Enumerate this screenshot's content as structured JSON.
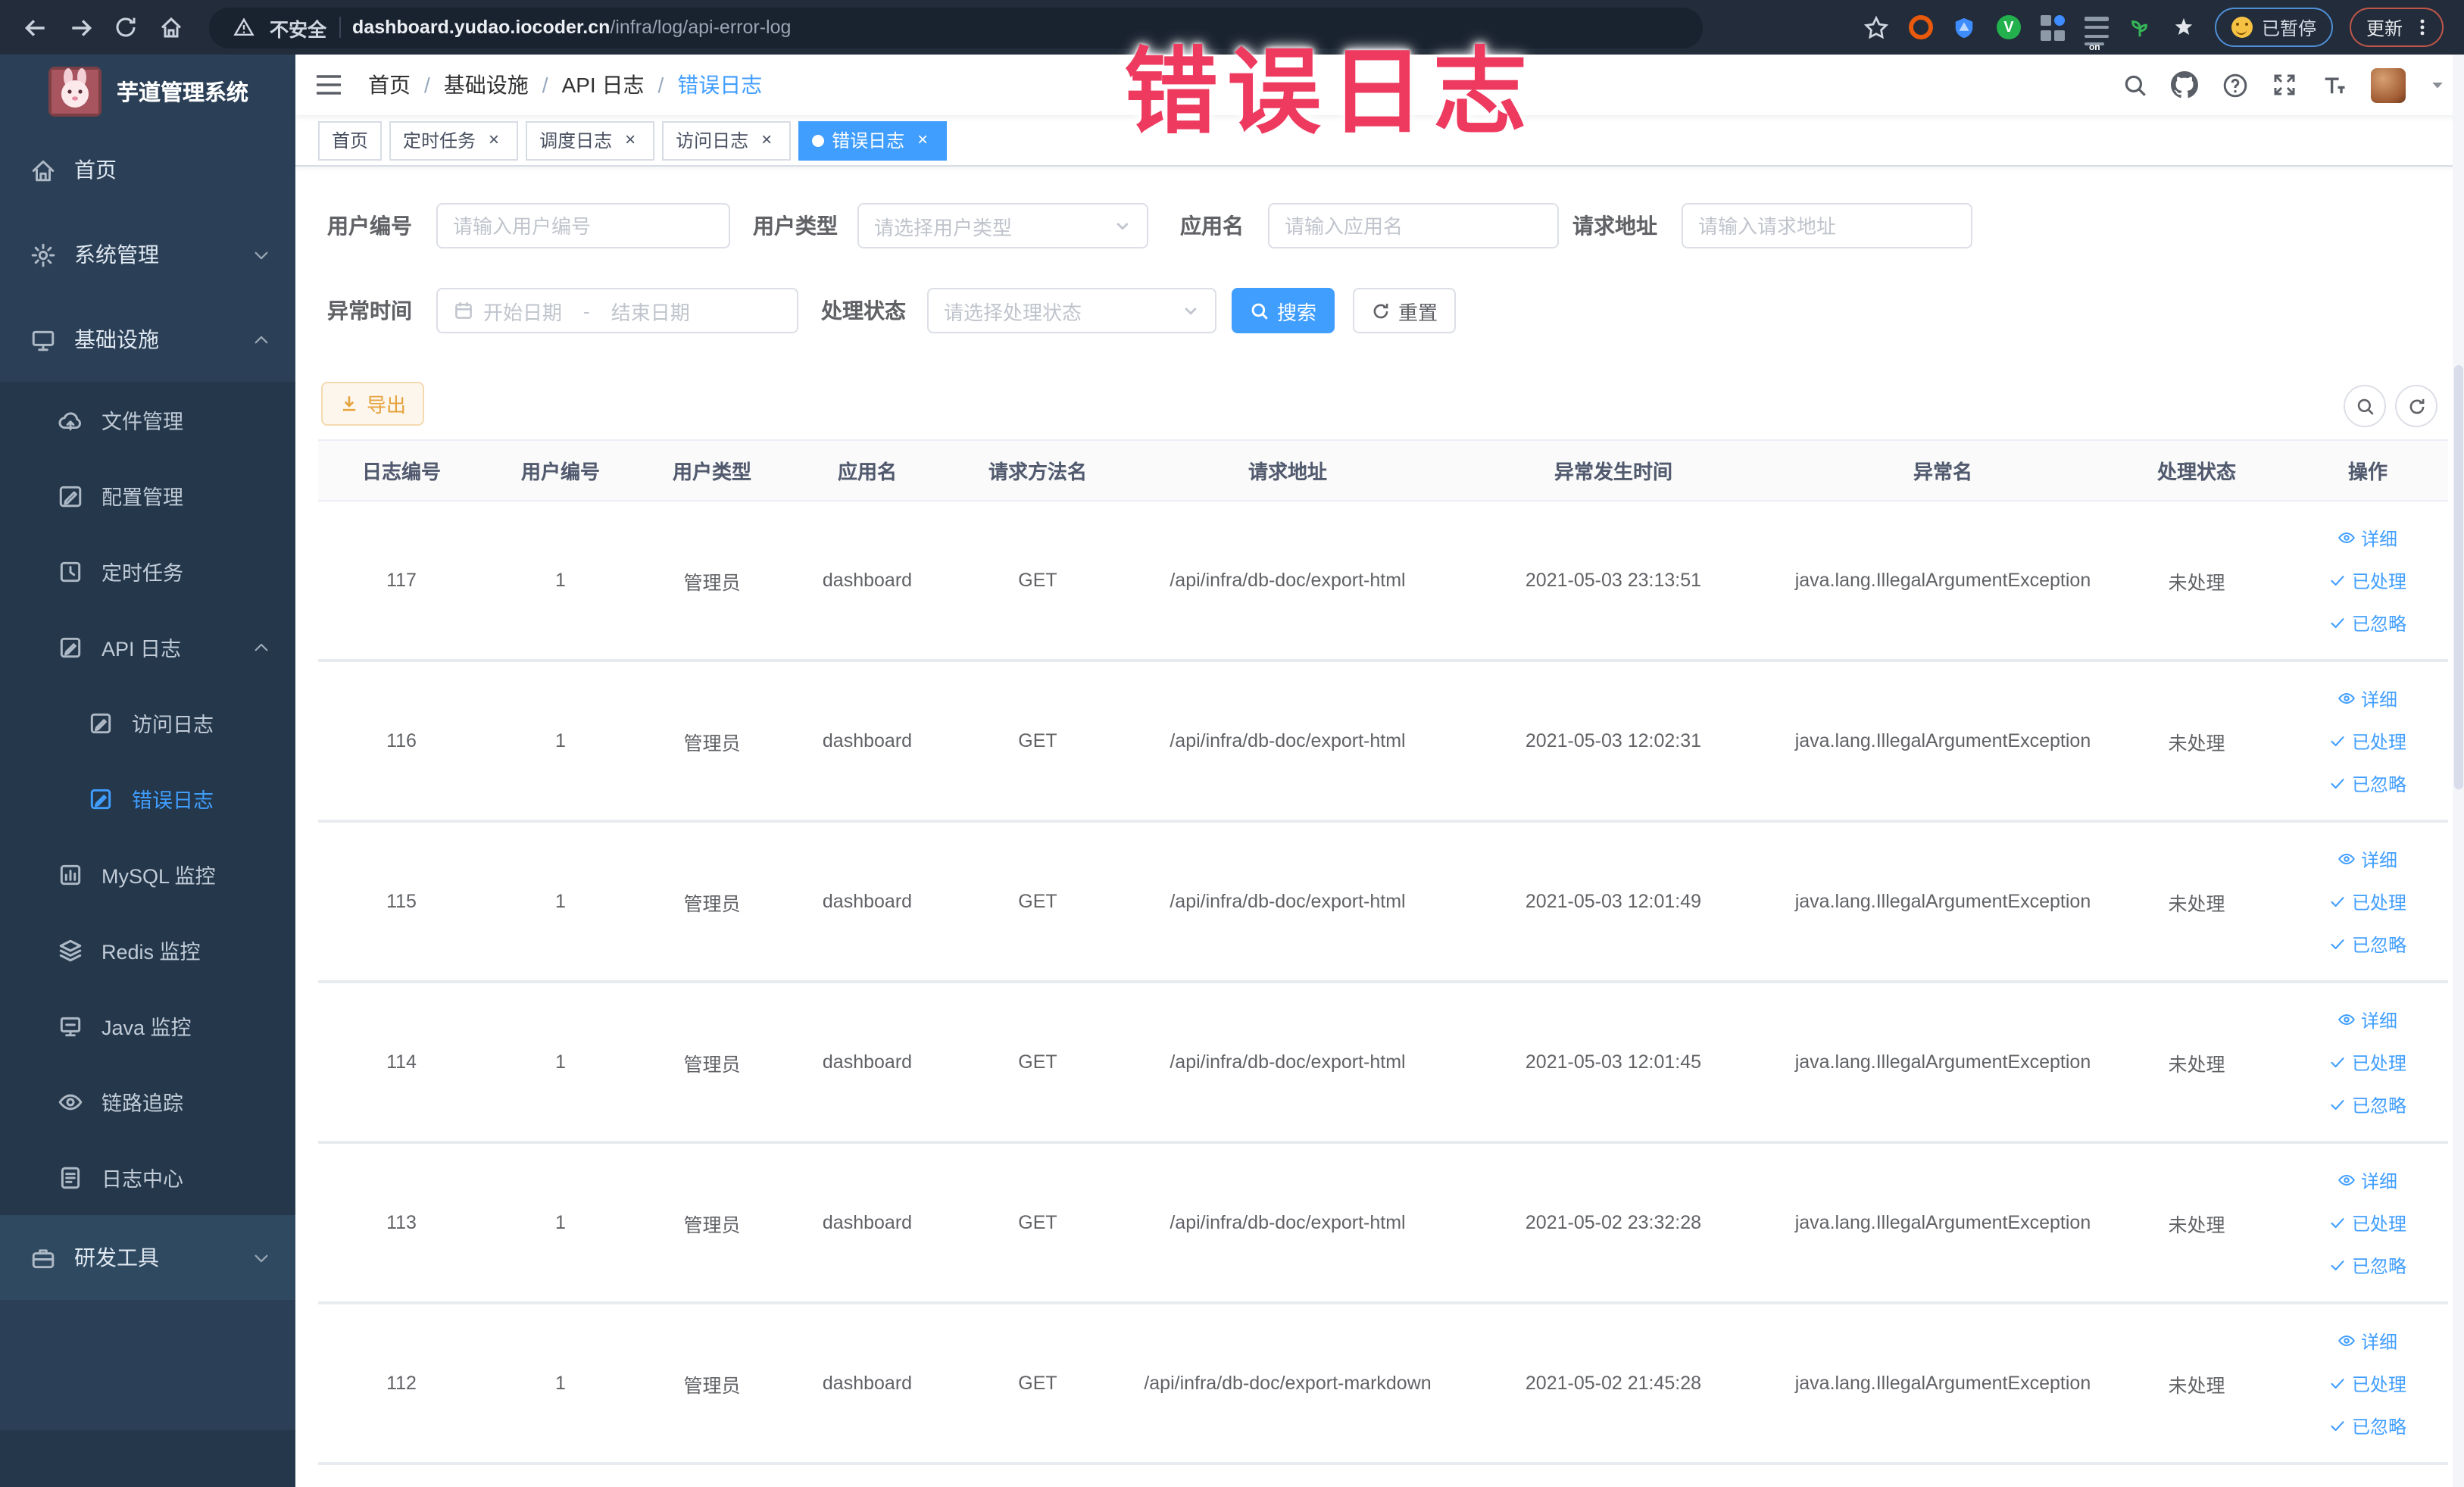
{
  "browser": {
    "security_label": "不安全",
    "url_domain": "dashboard.yudao.iocoder.cn",
    "url_path": "/infra/log/api-error-log",
    "paused_badge": "已暂停",
    "update_label": "更新"
  },
  "overlay_title": "错误日志",
  "sidebar": {
    "title": "芋道管理系统",
    "menu": [
      {
        "label": "首页",
        "icon": "home-icon",
        "level": 1
      },
      {
        "label": "系统管理",
        "icon": "gear-icon",
        "level": 1,
        "arrow": "down"
      },
      {
        "label": "基础设施",
        "icon": "monitor-icon",
        "level": 1,
        "arrow": "up"
      },
      {
        "label": "文件管理",
        "icon": "cloud-icon",
        "level": 2
      },
      {
        "label": "配置管理",
        "icon": "edit-icon",
        "level": 2
      },
      {
        "label": "定时任务",
        "icon": "task-icon",
        "level": 2
      },
      {
        "label": "API 日志",
        "icon": "log-icon",
        "level": 2,
        "arrow": "up"
      },
      {
        "label": "访问日志",
        "icon": "log-icon",
        "level": 3
      },
      {
        "label": "错误日志",
        "icon": "log-icon",
        "level": 3,
        "active": true
      },
      {
        "label": "MySQL 监控",
        "icon": "chart-icon",
        "level": 2
      },
      {
        "label": "Redis 监控",
        "icon": "layers-icon",
        "level": 2
      },
      {
        "label": "Java 监控",
        "icon": "java-monitor-icon",
        "level": 2
      },
      {
        "label": "链路追踪",
        "icon": "eye-icon",
        "level": 2
      },
      {
        "label": "日志中心",
        "icon": "document-icon",
        "level": 2
      },
      {
        "label": "研发工具",
        "icon": "briefcase-icon",
        "level": 1,
        "arrow": "down",
        "light": true
      }
    ]
  },
  "breadcrumb": [
    "首页",
    "基础设施",
    "API 日志",
    "错误日志"
  ],
  "tabs": [
    {
      "label": "首页",
      "closable": false,
      "active": false
    },
    {
      "label": "定时任务",
      "closable": true,
      "active": false
    },
    {
      "label": "调度日志",
      "closable": true,
      "active": false
    },
    {
      "label": "访问日志",
      "closable": true,
      "active": false
    },
    {
      "label": "错误日志",
      "closable": true,
      "active": true
    }
  ],
  "filters": {
    "user_id": {
      "label": "用户编号",
      "placeholder": "请输入用户编号"
    },
    "user_type": {
      "label": "用户类型",
      "placeholder": "请选择用户类型"
    },
    "app_name": {
      "label": "应用名",
      "placeholder": "请输入应用名"
    },
    "request_url": {
      "label": "请求地址",
      "placeholder": "请输入请求地址"
    },
    "exception_time": {
      "label": "异常时间",
      "start_placeholder": "开始日期",
      "separator": "-",
      "end_placeholder": "结束日期"
    },
    "process_status": {
      "label": "处理状态",
      "placeholder": "请选择处理状态"
    },
    "search_button": "搜索",
    "reset_button": "重置"
  },
  "toolbar": {
    "export_button": "导出"
  },
  "table": {
    "headers": [
      "日志编号",
      "用户编号",
      "用户类型",
      "应用名",
      "请求方法名",
      "请求地址",
      "异常发生时间",
      "异常名",
      "处理状态",
      "操作"
    ],
    "ops": [
      "详细",
      "已处理",
      "已忽略"
    ],
    "rows": [
      {
        "log_id": "117",
        "user_id": "1",
        "user_type": "管理员",
        "app_name": "dashboard",
        "method": "GET",
        "url": "/api/infra/db-doc/export-html",
        "time": "2021-05-03 23:13:51",
        "exception": "java.lang.IllegalArgumentException",
        "status": "未处理"
      },
      {
        "log_id": "116",
        "user_id": "1",
        "user_type": "管理员",
        "app_name": "dashboard",
        "method": "GET",
        "url": "/api/infra/db-doc/export-html",
        "time": "2021-05-03 12:02:31",
        "exception": "java.lang.IllegalArgumentException",
        "status": "未处理"
      },
      {
        "log_id": "115",
        "user_id": "1",
        "user_type": "管理员",
        "app_name": "dashboard",
        "method": "GET",
        "url": "/api/infra/db-doc/export-html",
        "time": "2021-05-03 12:01:49",
        "exception": "java.lang.IllegalArgumentException",
        "status": "未处理"
      },
      {
        "log_id": "114",
        "user_id": "1",
        "user_type": "管理员",
        "app_name": "dashboard",
        "method": "GET",
        "url": "/api/infra/db-doc/export-html",
        "time": "2021-05-03 12:01:45",
        "exception": "java.lang.IllegalArgumentException",
        "status": "未处理"
      },
      {
        "log_id": "113",
        "user_id": "1",
        "user_type": "管理员",
        "app_name": "dashboard",
        "method": "GET",
        "url": "/api/infra/db-doc/export-html",
        "time": "2021-05-02 23:32:28",
        "exception": "java.lang.IllegalArgumentException",
        "status": "未处理"
      },
      {
        "log_id": "112",
        "user_id": "1",
        "user_type": "管理员",
        "app_name": "dashboard",
        "method": "GET",
        "url": "/api/infra/db-doc/export-markdown",
        "time": "2021-05-02 21:45:28",
        "exception": "java.lang.IllegalArgumentException",
        "status": "未处理"
      }
    ]
  }
}
